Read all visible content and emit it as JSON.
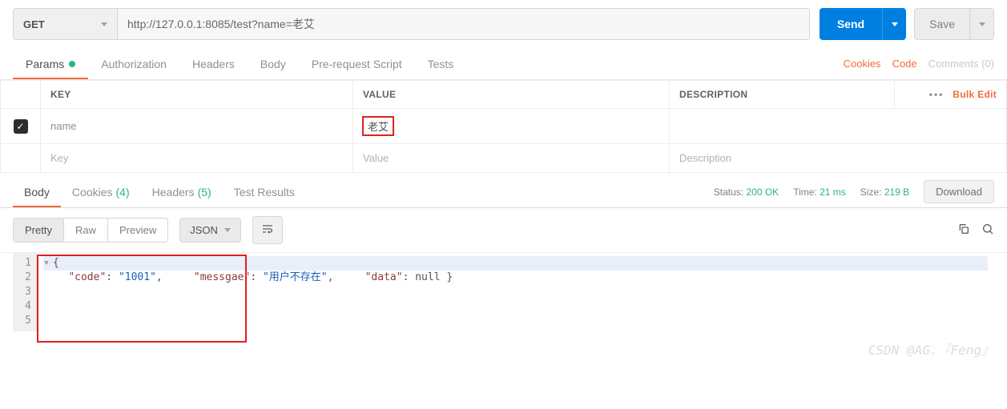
{
  "request": {
    "method": "GET",
    "url": "http://127.0.0.1:8085/test?name=老艾",
    "send_label": "Send",
    "save_label": "Save"
  },
  "tabs": {
    "items": [
      {
        "label": "Params",
        "active": true,
        "has_dot": true
      },
      {
        "label": "Authorization"
      },
      {
        "label": "Headers"
      },
      {
        "label": "Body"
      },
      {
        "label": "Pre-request Script"
      },
      {
        "label": "Tests"
      }
    ],
    "right": {
      "cookies": "Cookies",
      "code": "Code",
      "comments": "Comments (0)"
    }
  },
  "params_table": {
    "headers": {
      "key": "KEY",
      "value": "VALUE",
      "description": "DESCRIPTION"
    },
    "bulk_edit": "Bulk Edit",
    "rows": [
      {
        "checked": true,
        "key": "name",
        "value": "老艾",
        "description": ""
      }
    ],
    "placeholders": {
      "key": "Key",
      "value": "Value",
      "description": "Description"
    }
  },
  "response": {
    "tabs": [
      {
        "label": "Body",
        "active": true
      },
      {
        "label": "Cookies",
        "count": "(4)"
      },
      {
        "label": "Headers",
        "count": "(5)"
      },
      {
        "label": "Test Results"
      }
    ],
    "meta": {
      "status_label": "Status:",
      "status_value": "200 OK",
      "time_label": "Time:",
      "time_value": "21 ms",
      "size_label": "Size:",
      "size_value": "219 B",
      "download": "Download"
    },
    "view": {
      "modes": [
        {
          "label": "Pretty",
          "active": true
        },
        {
          "label": "Raw"
        },
        {
          "label": "Preview"
        }
      ],
      "format": "JSON"
    },
    "body_json": {
      "code": "1001",
      "messgae": "用户不存在",
      "data": null
    },
    "lines": [
      "1",
      "2",
      "3",
      "4",
      "5"
    ]
  },
  "watermark": "CSDN @AG.『Feng』"
}
